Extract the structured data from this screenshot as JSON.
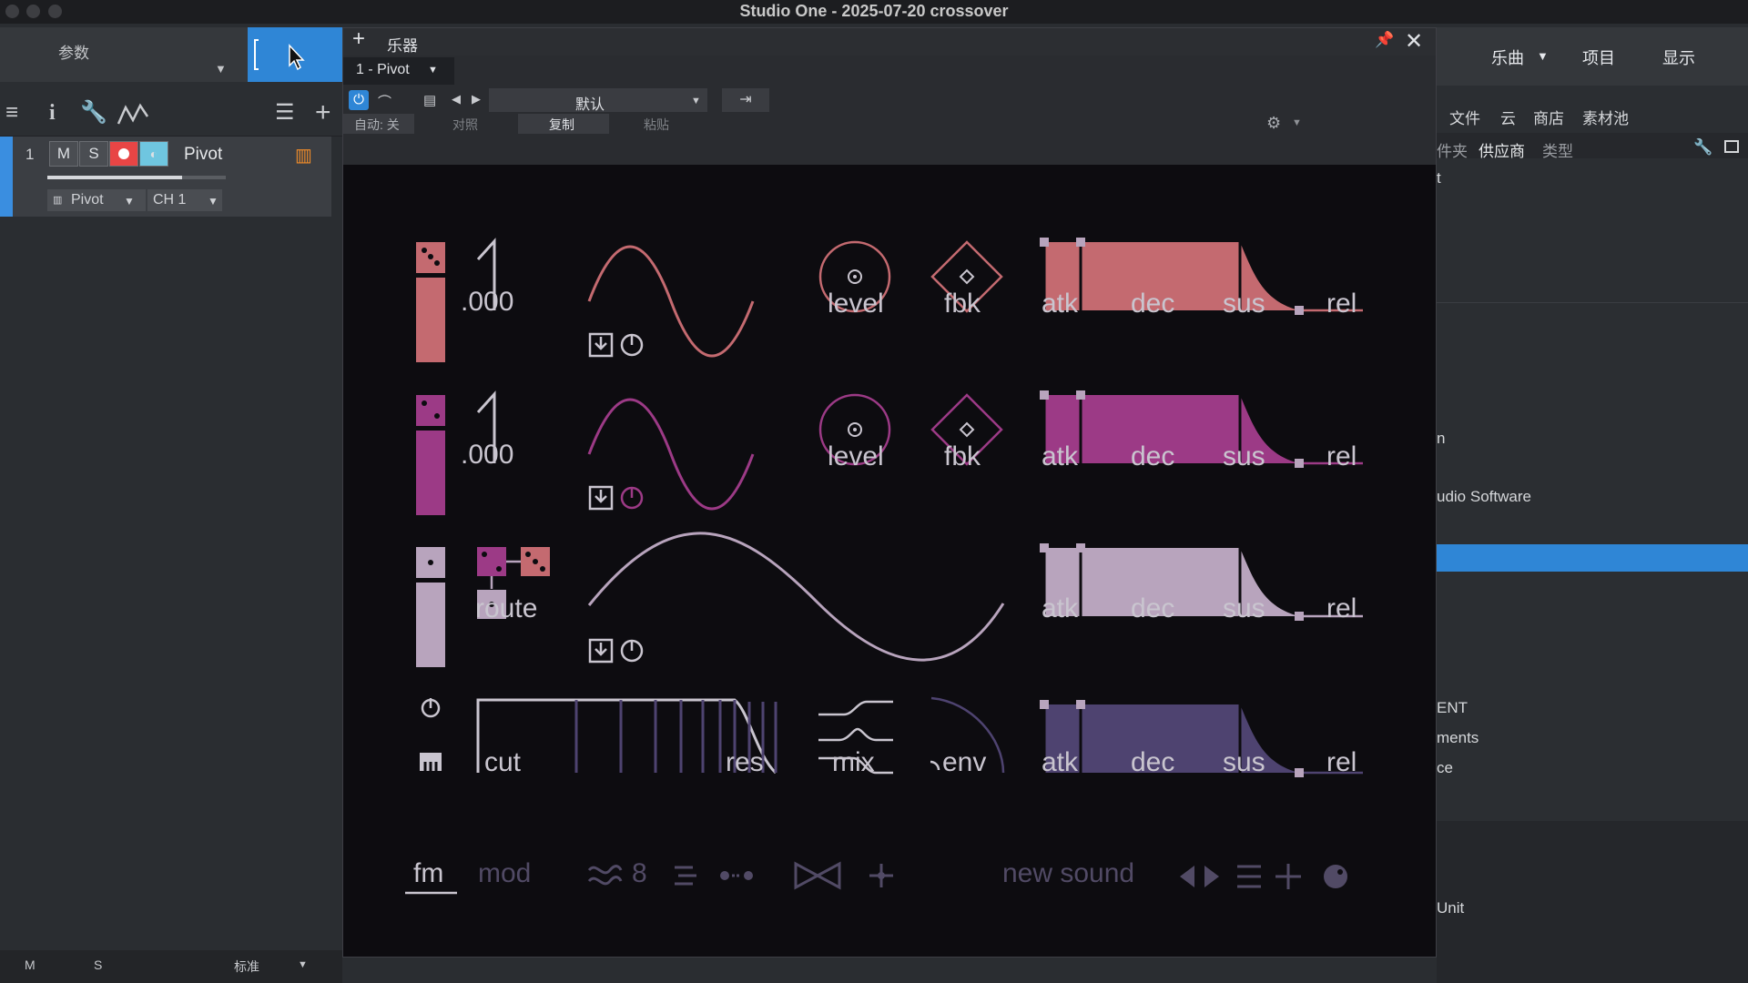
{
  "app": {
    "title": "Studio One - 2025-07-20 crossover"
  },
  "left": {
    "param_label": "参数",
    "track_number": "1",
    "mute": "M",
    "solo": "S",
    "track_name": "Pivot",
    "instrument": "Pivot",
    "channel": "CH 1",
    "bottom_m": "M",
    "bottom_s": "S",
    "bottom_mode": "标准"
  },
  "window": {
    "add": "+",
    "title": "乐器",
    "preset_slot": "1 - Pivot",
    "preset_name": "默认",
    "auto": "自动: 关",
    "compare": "对照",
    "copy": "复制",
    "paste": "粘贴"
  },
  "right": {
    "song": "乐曲",
    "project": "项目",
    "show": "显示",
    "tabs": [
      "文件",
      "云",
      "商店",
      "素材池"
    ],
    "sub_tabs": [
      "件夹",
      "供应商",
      "类型"
    ],
    "list": [
      "t",
      "n",
      "udio Software",
      "ENT",
      "ments",
      "ce",
      "Unit"
    ]
  },
  "synth": {
    "rows": [
      {
        "value_top": "1",
        "value": ".000",
        "knob1": "level",
        "knob2": "fbk",
        "color": "#c46a70"
      },
      {
        "value_top": "1",
        "value": ".000",
        "knob1": "level",
        "knob2": "fbk",
        "color": "#9c3a86"
      },
      {
        "value": "route",
        "color": "#b8a4bd"
      },
      {
        "cut": "cut",
        "res": "res",
        "mix": "mix",
        "env": "env",
        "color": "#4e4370"
      }
    ],
    "env_labels": [
      "atk",
      "dec",
      "sus",
      "rel"
    ],
    "footer": {
      "tab_fm": "fm",
      "tab_mod": "mod",
      "voices": "8",
      "preset": "new sound"
    }
  },
  "colors": {
    "accent": "#2f86d6",
    "coral": "#c46a70",
    "magenta": "#9c3a86",
    "lilac": "#b8a4bd",
    "violet": "#4e4370",
    "bg": "#0d0c10"
  }
}
